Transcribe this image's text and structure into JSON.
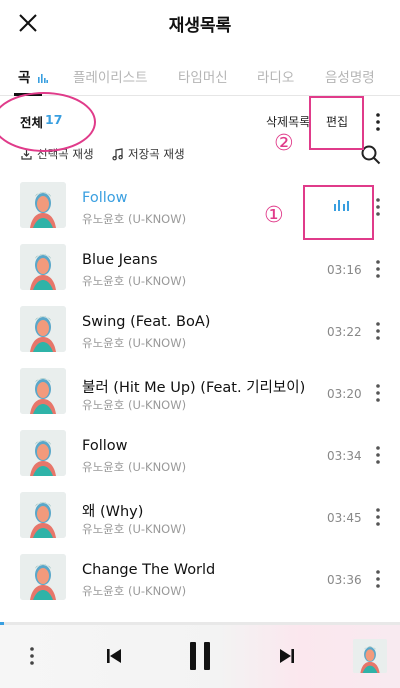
{
  "header": {
    "title": "재생목록",
    "close_icon": "close-icon"
  },
  "tabs": [
    {
      "label": "곡",
      "active": true
    },
    {
      "label": "플레이리스트",
      "active": false
    },
    {
      "label": "타임머신",
      "active": false
    },
    {
      "label": "라디오",
      "active": false
    },
    {
      "label": "음성명령",
      "active": false
    }
  ],
  "list_header": {
    "total_label": "전체",
    "total_count": "17",
    "delete_list_label": "삭제목록",
    "edit_label": "편집"
  },
  "actions": {
    "play_selected_label": "선택곡 재생",
    "play_saved_label": "저장곡 재생"
  },
  "songs": [
    {
      "title": "Follow",
      "artist": "유노윤호 (U-KNOW)",
      "duration": "",
      "playing": true
    },
    {
      "title": "Blue Jeans",
      "artist": "유노윤호 (U-KNOW)",
      "duration": "03:16",
      "playing": false
    },
    {
      "title": "Swing (Feat. BoA)",
      "artist": "유노윤호 (U-KNOW)",
      "duration": "03:22",
      "playing": false
    },
    {
      "title": "불러 (Hit Me Up) (Feat. 기리보이)",
      "artist": "유노윤호 (U-KNOW)",
      "duration": "03:20",
      "playing": false
    },
    {
      "title": "Follow",
      "artist": "유노윤호 (U-KNOW)",
      "duration": "03:34",
      "playing": false
    },
    {
      "title": "왜 (Why)",
      "artist": "유노윤호 (U-KNOW)",
      "duration": "03:45",
      "playing": false
    },
    {
      "title": "Change The World",
      "artist": "유노윤호 (U-KNOW)",
      "duration": "03:36",
      "playing": false
    }
  ],
  "annotations": {
    "marker_1": "①",
    "marker_2": "②"
  },
  "player": {
    "progress_fraction": 0.01
  },
  "colors": {
    "accent": "#3a9fe0",
    "annotation": "#e03b8a"
  }
}
